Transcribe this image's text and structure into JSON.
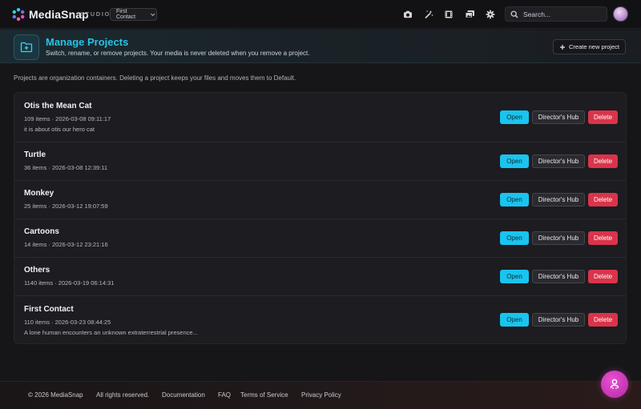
{
  "app": {
    "brand": "MediaSnap",
    "studio": "STUDIO",
    "current_project": "First Contact",
    "search_placeholder": "Search..."
  },
  "toolbar": {
    "icons": [
      "camera-icon",
      "magic-wand-icon",
      "film-icon",
      "gallery-icon",
      "gear-icon"
    ]
  },
  "header": {
    "title": "Manage Projects",
    "subtitle": "Switch, rename, or remove projects. Your media is never deleted when you remove a project.",
    "create_label": "Create new project"
  },
  "info": "Projects are organization containers. Deleting a project keeps your files and moves them to Default.",
  "actions": {
    "open": "Open",
    "hub": "Director's Hub",
    "delete": "Delete"
  },
  "projects": [
    {
      "name": "Otis the Mean Cat",
      "meta": "109 items · 2026-03-08 09:11:17",
      "desc": "it is about otis our hero cat"
    },
    {
      "name": "Turtle",
      "meta": "36 items · 2026-03-08 12:39:11",
      "desc": ""
    },
    {
      "name": "Monkey",
      "meta": "25 items · 2026-03-12 19:07:59",
      "desc": ""
    },
    {
      "name": "Cartoons",
      "meta": "14 items · 2026-03-12 23:21:16",
      "desc": ""
    },
    {
      "name": "Others",
      "meta": "1140 items · 2026-03-19 06:14:31",
      "desc": ""
    },
    {
      "name": "First Contact",
      "meta": "110 items · 2026-03-23 08:44:25",
      "desc": "A lone human encounters an unknown extraterrestrial presence..."
    }
  ],
  "footer": {
    "copyright": "© 2026 MediaSnap",
    "rights": "All rights reserved.",
    "links": [
      "Documentation",
      "FAQ",
      "Terms of Service",
      "Privacy Policy"
    ]
  },
  "colors": {
    "accent": "#27c3e6",
    "open_button": "#19c4ee",
    "delete_button": "#d9344a",
    "fab": "#c93ab8"
  }
}
